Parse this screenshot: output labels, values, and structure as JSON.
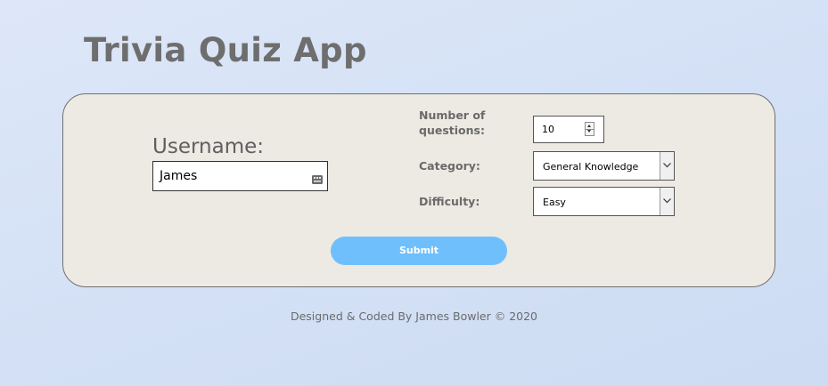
{
  "app": {
    "title": "Trivia Quiz App"
  },
  "form": {
    "username_label": "Username:",
    "username_value": "James",
    "num_questions_label": "Number of questions:",
    "num_questions_value": "10",
    "category_label": "Category:",
    "category_value": "General Knowledge",
    "difficulty_label": "Difficulty:",
    "difficulty_value": "Easy",
    "submit_label": "Submit"
  },
  "footer": {
    "text": "Designed & Coded By James Bowler © 2020"
  },
  "icons": {
    "username_field": "keyboard-icon",
    "number_field": "spinner-icon",
    "dropdowns": "chevron-down-icon"
  },
  "colors": {
    "title": "#6e6e6e",
    "card_background": "#edeae3",
    "submit_background": "#6fbffd",
    "submit_text": "#ffffff"
  }
}
